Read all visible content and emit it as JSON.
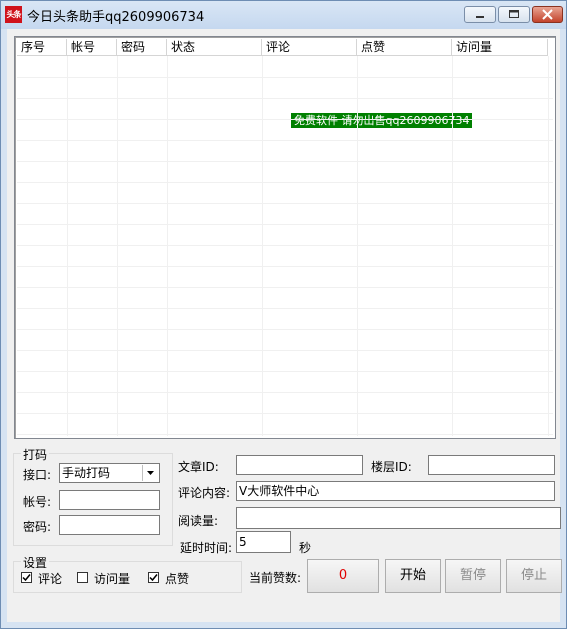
{
  "window": {
    "icon_text": "头条",
    "title": "今日头条助手qq2609906734"
  },
  "list": {
    "columns": [
      "序号",
      "帐号",
      "密码",
      "状态",
      "评论",
      "点赞",
      "访问量"
    ],
    "rows": [],
    "watermark": "免费软件 请勿出售qq2609906734"
  },
  "captcha": {
    "group_title": "打码",
    "interface_label": "接口:",
    "interface_value": "手动打码",
    "account_label": "帐号:",
    "account_value": "",
    "password_label": "密码:",
    "password_value": ""
  },
  "article": {
    "article_id_label": "文章ID:",
    "article_id_value": "",
    "floor_id_label": "楼层ID:",
    "floor_id_value": "",
    "comment_label": "评论内容:",
    "comment_value": "V大师软件中心",
    "read_label": "阅读量:",
    "read_value": "",
    "delay_label": "延时时间:",
    "delay_value": "5",
    "delay_unit": "秒"
  },
  "settings": {
    "group_title": "设置",
    "options": [
      {
        "label": "评论",
        "checked": true
      },
      {
        "label": "访问量",
        "checked": false
      },
      {
        "label": "点赞",
        "checked": true
      }
    ]
  },
  "controls": {
    "likes_label": "当前赞数:",
    "likes_value": "0",
    "start_label": "开始",
    "pause_label": "暂停",
    "stop_label": "停止"
  },
  "colors": {
    "watermark_bg": "#008000",
    "counter_text": "#e00000",
    "icon_bg": "#d0121b"
  }
}
